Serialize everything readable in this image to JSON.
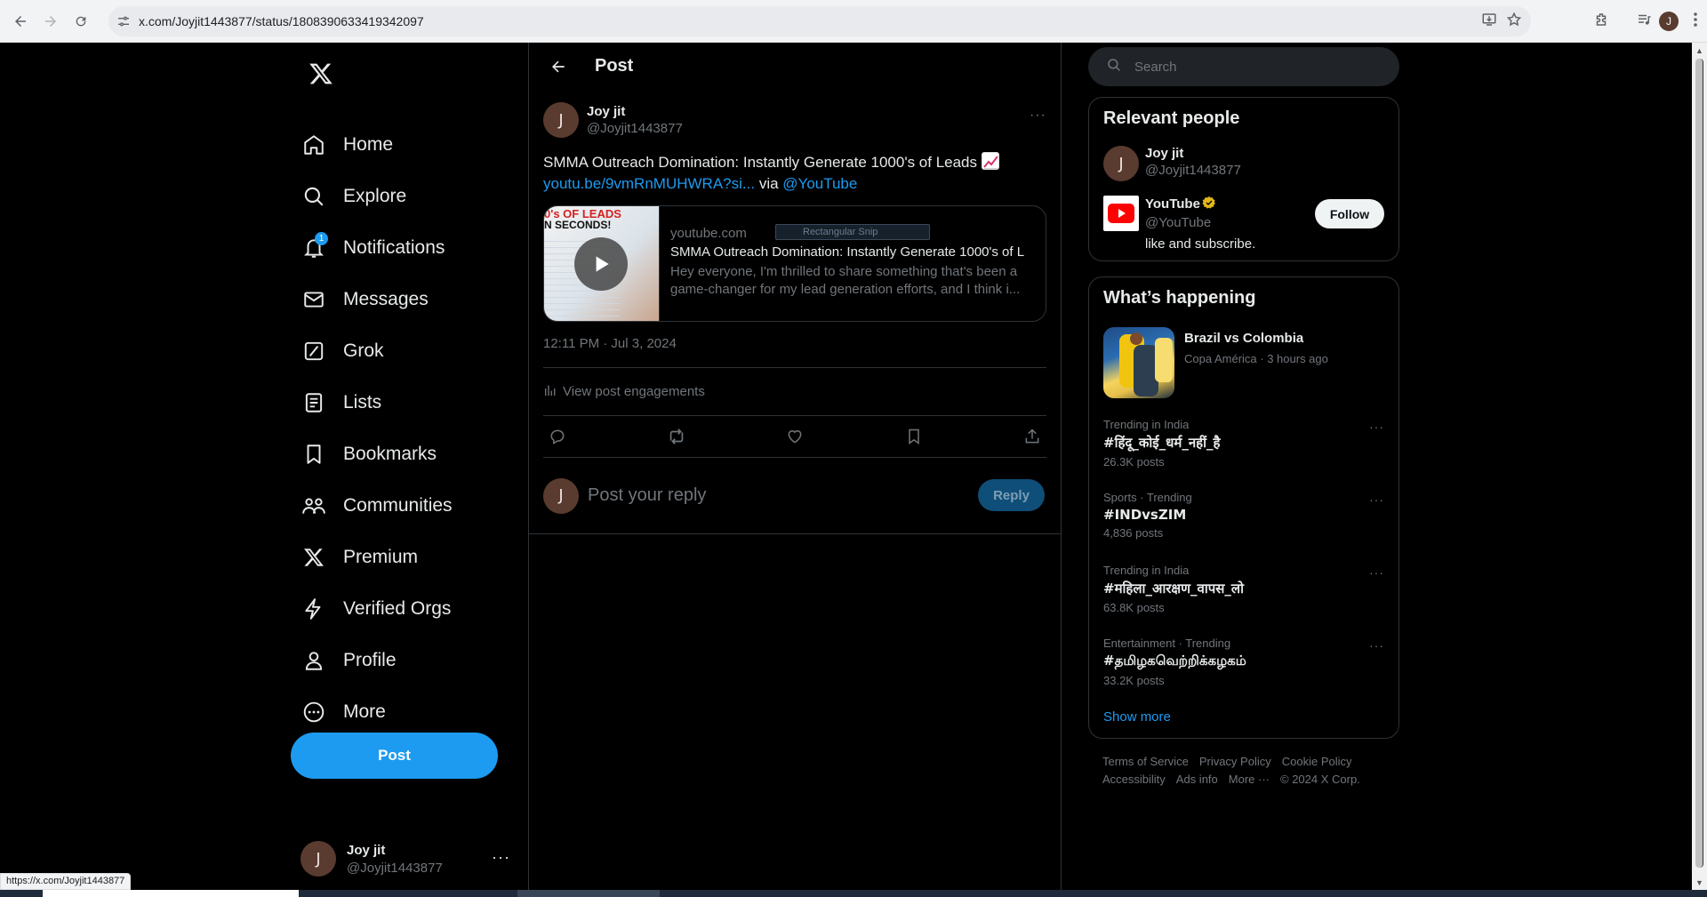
{
  "browser": {
    "url": "x.com/Joyjit1443877/status/1808390633419342097",
    "profile_initial": "J",
    "status_url": "https://x.com/Joyjit1443877"
  },
  "sidebar": {
    "items": [
      {
        "label": "Home",
        "icon": "home-icon"
      },
      {
        "label": "Explore",
        "icon": "search-icon"
      },
      {
        "label": "Notifications",
        "icon": "bell-icon",
        "badge": "1"
      },
      {
        "label": "Messages",
        "icon": "envelope-icon"
      },
      {
        "label": "Grok",
        "icon": "grok-icon"
      },
      {
        "label": "Lists",
        "icon": "list-icon"
      },
      {
        "label": "Bookmarks",
        "icon": "bookmark-icon"
      },
      {
        "label": "Communities",
        "icon": "communities-icon"
      },
      {
        "label": "Premium",
        "icon": "x-logo-icon"
      },
      {
        "label": "Verified Orgs",
        "icon": "lightning-icon"
      },
      {
        "label": "Profile",
        "icon": "person-icon"
      },
      {
        "label": "More",
        "icon": "more-circle-icon"
      }
    ],
    "post_button": "Post",
    "account": {
      "initial": "J",
      "name": "Joy jit",
      "handle": "@Joyjit1443877"
    }
  },
  "main": {
    "header_title": "Post",
    "tweet": {
      "author_initial": "J",
      "author_name": "Joy jit",
      "author_handle": "@Joyjit1443877",
      "text": "SMMA Outreach Domination: Instantly Generate 1000's of Leads",
      "link": "youtu.be/9vmRnMUHWRA?si...",
      "via": "via",
      "mention": "@YouTube",
      "card": {
        "domain": "youtube.com",
        "title": "SMMA Outreach Domination: Instantly Generate 1000's of L",
        "description": "Hey everyone, I'm thrilled to share something that's been a game-changer for my lead generation efforts, and I think i...",
        "thumb_line1": "0's OF LEADS",
        "thumb_line2": "N SECONDS!",
        "tooltip": "Rectangular Snip"
      },
      "timestamp": "12:11 PM · Jul 3, 2024",
      "engagements": "View post engagements"
    },
    "reply": {
      "initial": "J",
      "placeholder": "Post your reply",
      "button": "Reply"
    }
  },
  "right": {
    "search_placeholder": "Search",
    "relevant": {
      "title": "Relevant people",
      "people": [
        {
          "initial": "J",
          "name": "Joy jit",
          "handle": "@Joyjit1443877"
        },
        {
          "name": "YouTube",
          "handle": "@YouTube",
          "bio": "like and subscribe.",
          "follow": "Follow"
        }
      ]
    },
    "happening": {
      "title": "What’s happening",
      "event": {
        "title": "Brazil vs Colombia",
        "meta": "Copa América · 3 hours ago"
      },
      "trends": [
        {
          "context": "Trending in India",
          "tag": "#हिंदू_कोई_धर्म_नहीं_है",
          "count": "26.3K posts"
        },
        {
          "context": "Sports · Trending",
          "tag": "#INDvsZIM",
          "count": "4,836 posts"
        },
        {
          "context": "Trending in India",
          "tag": "#महिला_आरक्षण_वापस_लो",
          "count": "63.8K posts"
        },
        {
          "context": "Entertainment · Trending",
          "tag": "#தமிழகவெற்றிக்கழகம்",
          "count": "33.2K posts"
        }
      ],
      "show_more": "Show more"
    },
    "footer": {
      "links": [
        "Terms of Service",
        "Privacy Policy",
        "Cookie Policy",
        "Accessibility",
        "Ads info",
        "More ···",
        "© 2024 X Corp."
      ]
    }
  },
  "colors": {
    "accent": "#1d9bf0",
    "background": "#000000",
    "border": "#2f3336",
    "muted": "#71767b"
  }
}
